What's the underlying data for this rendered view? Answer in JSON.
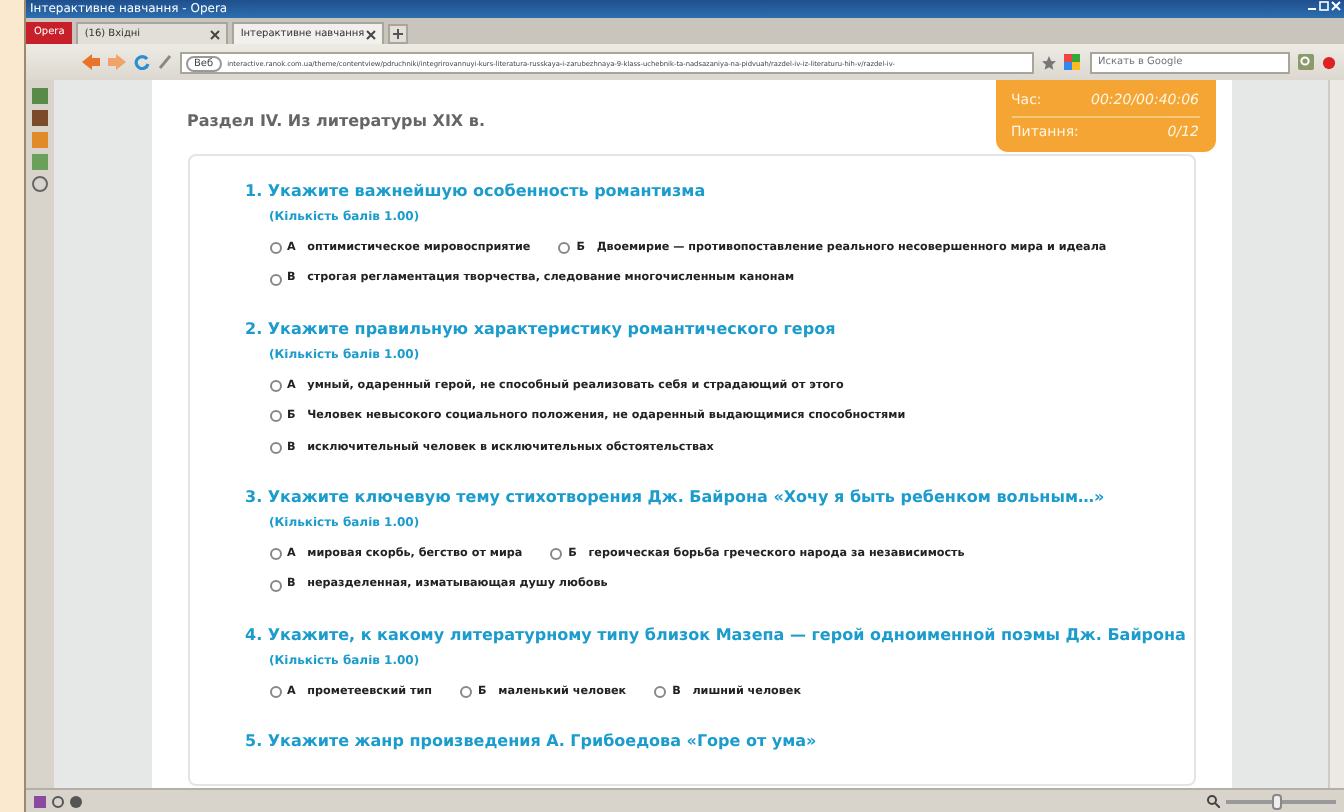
{
  "window": {
    "title": "Інтерактивне навчання - Opera",
    "menu_button": "Opera"
  },
  "tabs": [
    {
      "label": "(16) Вхідні",
      "selected": false
    },
    {
      "label": "Інтерактивне навчання",
      "selected": true
    }
  ],
  "toolbar": {
    "security_label": "Веб",
    "url": "interactive.ranok.com.ua/theme/contentview/pdruchniki/integrirovannuyi-kurs-literatura-russkaya-i-zarubezhnaya-9-klass-uchebnik-ta-nadsazaniya-na-pidvuah/razdel-iv-iz-literaturu-hih-v/razdel-iv-",
    "search_placeholder": "Искать в Google"
  },
  "page": {
    "section_title": "Раздел IV. Из литературы XIX в.",
    "timer": [
      {
        "label": "Час:",
        "value": "00:20/00:40:06"
      },
      {
        "label": "Питання:",
        "value": "0/12"
      }
    ],
    "questions": [
      {
        "number": "1.",
        "text": "Укажите важнейшую особенность романтизма",
        "points": "(Кількість балів 1.00)",
        "option_rows": [
          [
            {
              "letter": "А",
              "text": "оптимистическое мировосприятие",
              "selected": false
            },
            {
              "letter": "Б",
              "text": "Двоемирие — противопоставление реального несовершенного мира и идеала",
              "selected": false
            }
          ],
          [
            {
              "letter": "В",
              "text": "строгая регламентация творчества, следование многочисленным канонам",
              "selected": false
            }
          ]
        ]
      },
      {
        "number": "2.",
        "text": "Укажите правильную характеристику романтического героя",
        "points": "(Кількість балів 1.00)",
        "option_rows": [
          [
            {
              "letter": "А",
              "text": "умный, одаренный герой, не способный реализовать себя и страдающий от этого",
              "selected": false
            }
          ],
          [
            {
              "letter": "Б",
              "text": "Человек невысокого социального положения, не одаренный выдающимися способностями",
              "selected": false
            }
          ],
          [
            {
              "letter": "В",
              "text": "исключительный человек в исключительных обстоятельствах",
              "selected": false
            }
          ]
        ]
      },
      {
        "number": "3.",
        "text": "Укажите ключевую тему стихотворения Дж. Байрона «Хочу я быть ребенком вольным…»",
        "points": "(Кількість балів 1.00)",
        "option_rows": [
          [
            {
              "letter": "А",
              "text": "мировая скорбь, бегство от мира",
              "selected": false
            },
            {
              "letter": "Б",
              "text": "героическая борьба греческого народа за независимость",
              "selected": false
            }
          ],
          [
            {
              "letter": "В",
              "text": "неразделенная, изматывающая душу любовь",
              "selected": false
            }
          ]
        ]
      },
      {
        "number": "4.",
        "text": "Укажите, к какому литературному типу близок Мазепа — герой одноименной поэмы Дж. Байрона",
        "points": "(Кількість балів 1.00)",
        "option_rows": [
          [
            {
              "letter": "А",
              "text": "прометеевский тип",
              "selected": false
            },
            {
              "letter": "Б",
              "text": "маленький человек",
              "selected": false
            },
            {
              "letter": "В",
              "text": "лишний человек",
              "selected": false
            }
          ]
        ]
      },
      {
        "number": "5.",
        "text": "Укажите жанр произведения А. Грибоедова «Горе от ума»"
      }
    ]
  },
  "status_bar": {
    "zoom": {
      "level": 0.45
    }
  }
}
